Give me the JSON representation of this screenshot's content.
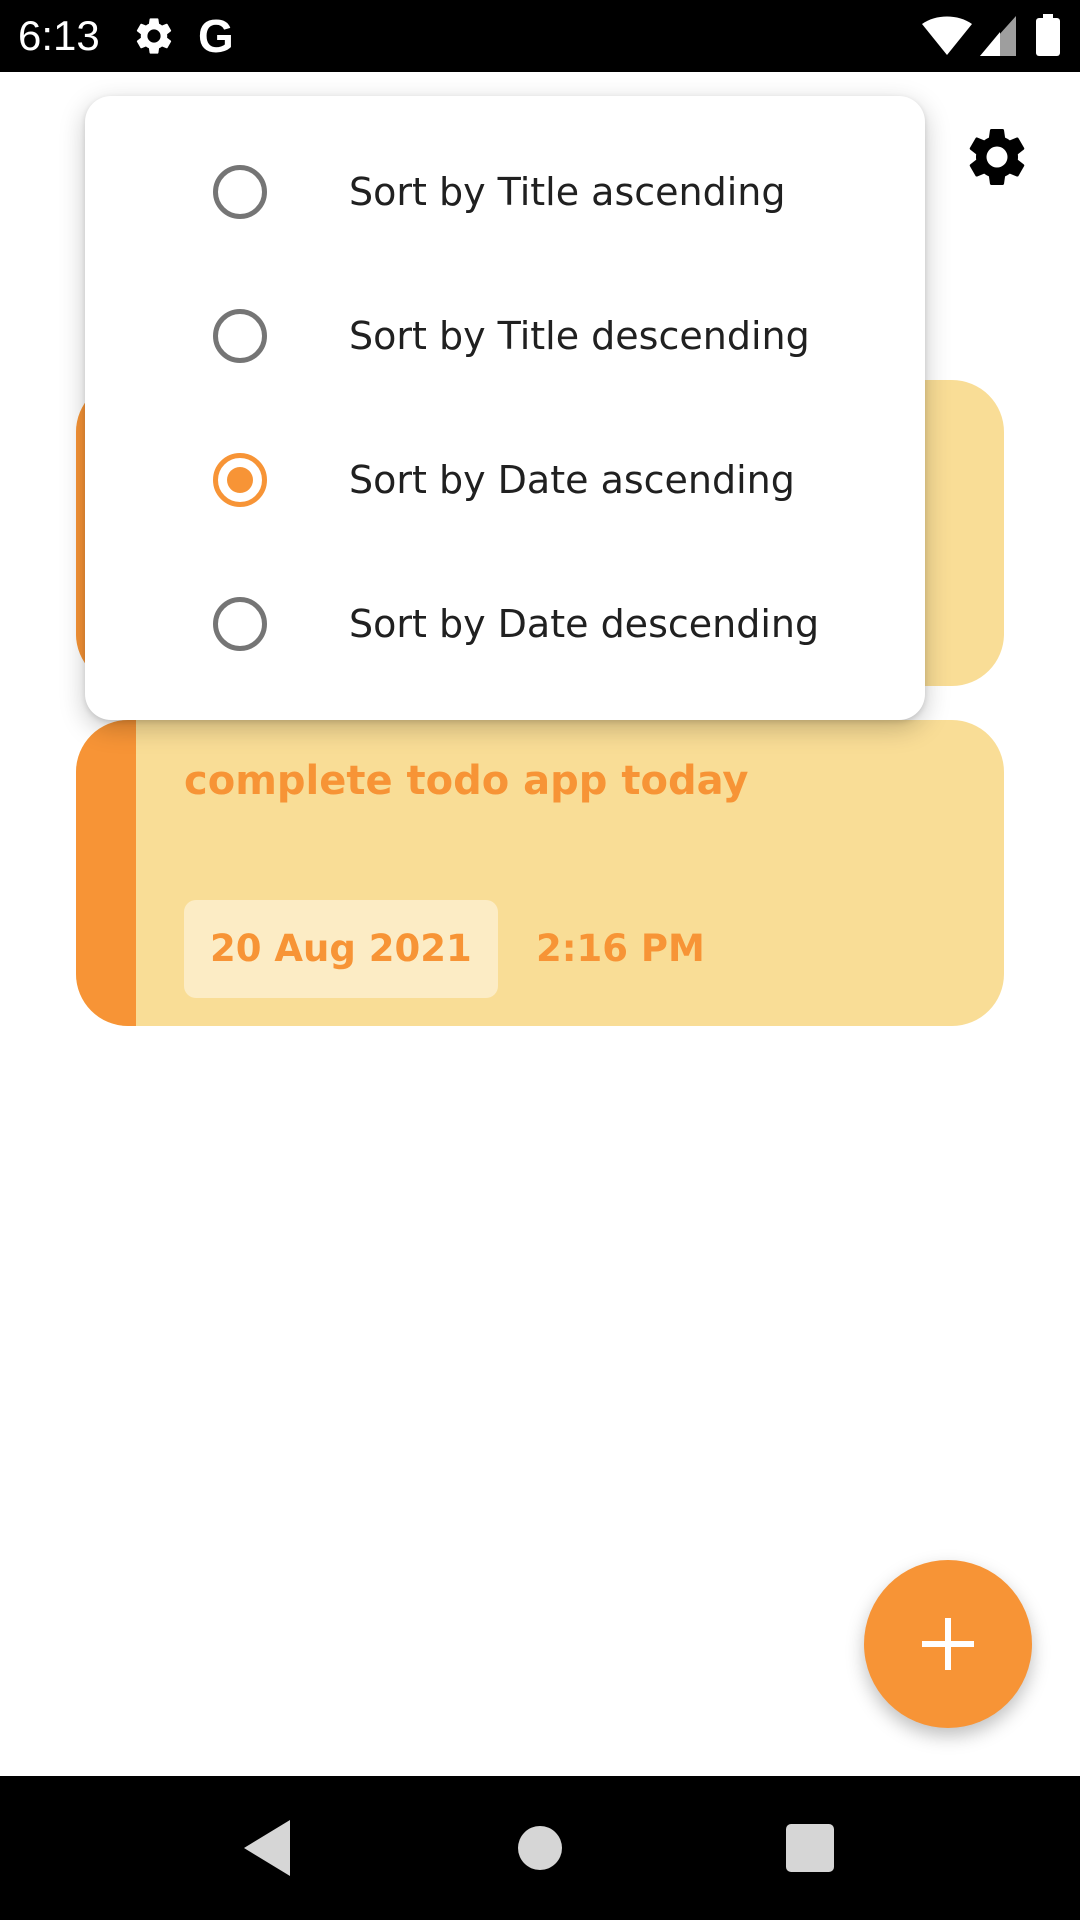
{
  "status_bar": {
    "time": "6:13",
    "g_label": "G",
    "icons": [
      "gear-icon",
      "google-g-icon",
      "wifi-icon",
      "signal-icon",
      "battery-icon"
    ]
  },
  "header": {
    "settings_icon": "gear-icon"
  },
  "sort_menu": {
    "options": [
      {
        "label": "Sort by Title ascending",
        "selected": false
      },
      {
        "label": "Sort by Title descending",
        "selected": false
      },
      {
        "label": "Sort by Date ascending",
        "selected": true
      },
      {
        "label": "Sort by Date descending",
        "selected": false
      }
    ]
  },
  "todos": [
    {
      "title": "complete todo app today",
      "date": "20 Aug 2021",
      "time": "2:16 PM"
    }
  ],
  "fab": {
    "icon": "plus-icon"
  },
  "nav_bar": {
    "icons": [
      "back-icon",
      "home-icon",
      "recents-icon"
    ]
  },
  "colors": {
    "accent": "#f79436",
    "card_background": "#f9dd96",
    "chip_background": "#fcecc5",
    "radio_unselected": "#757575"
  }
}
